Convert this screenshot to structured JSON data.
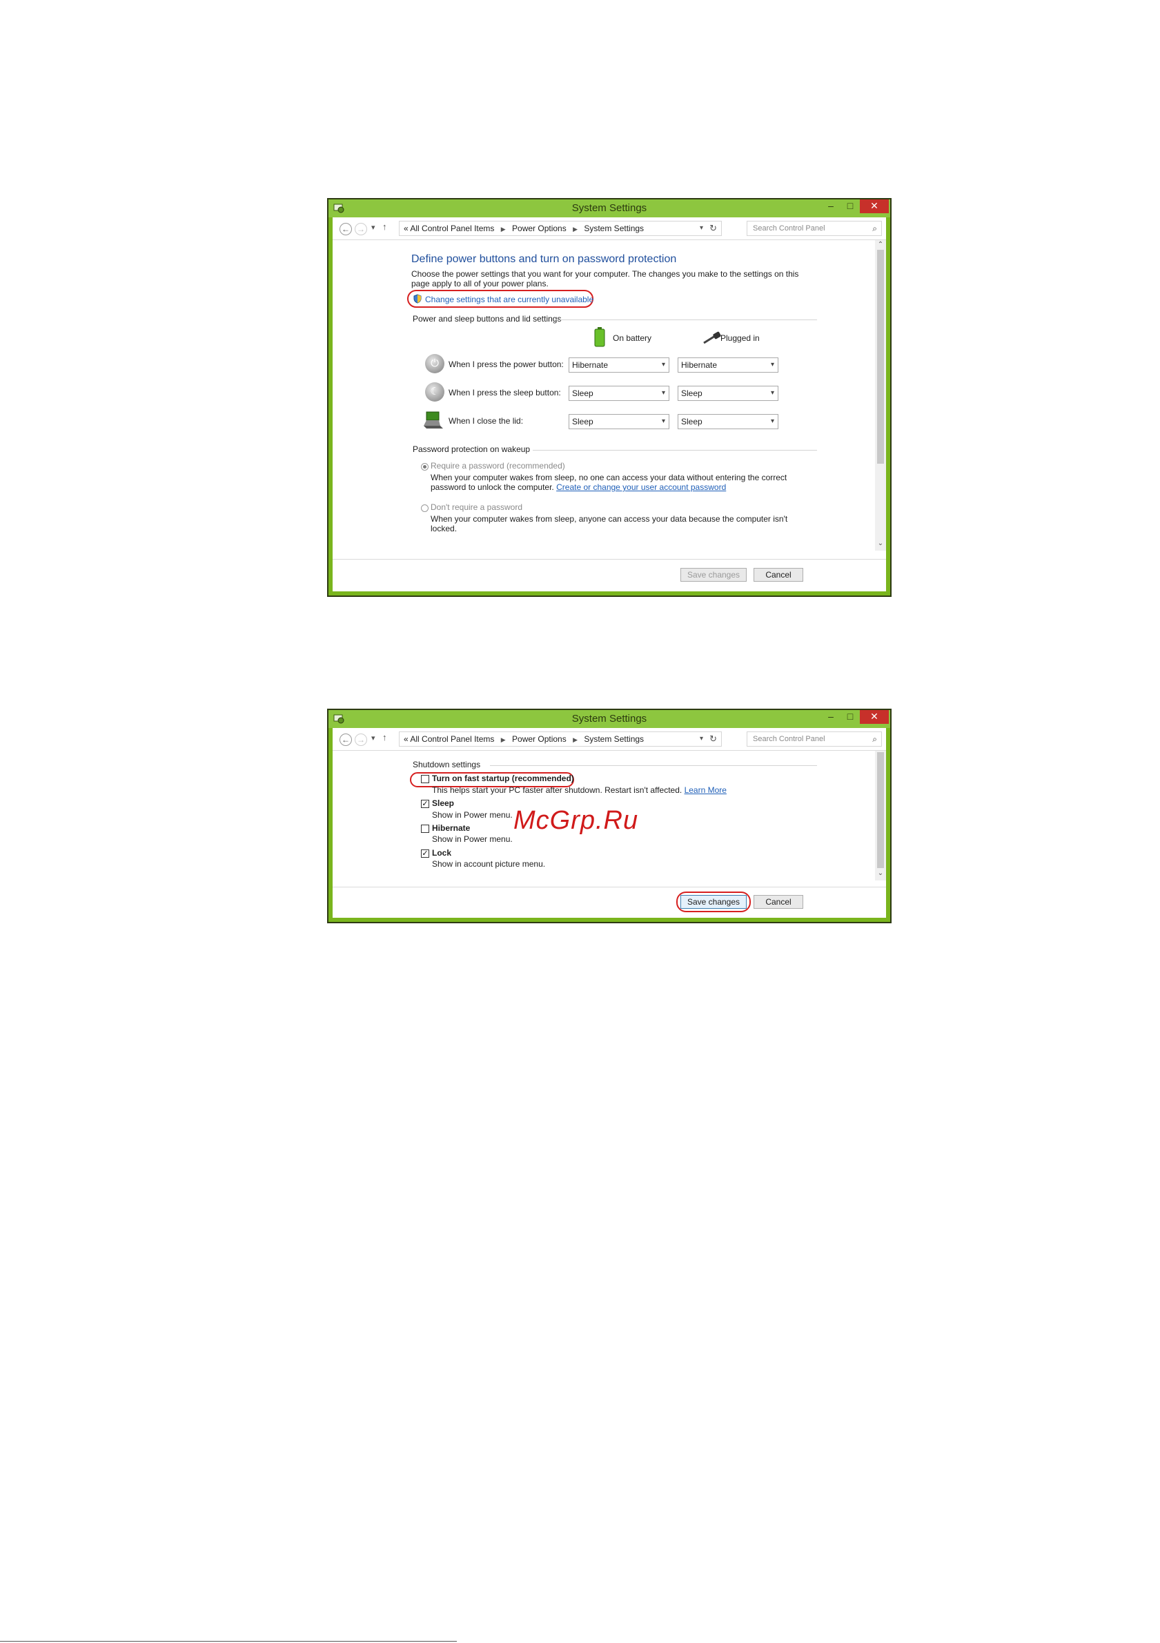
{
  "window1": {
    "title": "System Settings",
    "nav": {
      "back_icon": "back-arrow-icon",
      "forward_icon": "forward-arrow-icon",
      "breadcrumb_prefix": "«",
      "breadcrumb": [
        "All Control Panel Items",
        "Power Options",
        "System Settings"
      ],
      "search_placeholder": "Search Control Panel"
    },
    "heading": "Define power buttons and turn on password protection",
    "description_line1": "Choose the power settings that you want for your computer. The changes you make to the settings on this",
    "description_line2": "page apply to all of your power plans.",
    "change_link": "Change settings that are currently unavailable",
    "group_power": "Power and sleep buttons and lid settings",
    "col_battery": "On battery",
    "col_plugged": "Plugged in",
    "rows": [
      {
        "label": "When I press the power button:",
        "battery": "Hibernate",
        "plugged": "Hibernate"
      },
      {
        "label": "When I press the sleep button:",
        "battery": "Sleep",
        "plugged": "Sleep"
      },
      {
        "label": "When I close the lid:",
        "battery": "Sleep",
        "plugged": "Sleep"
      }
    ],
    "group_password": "Password protection on wakeup",
    "opt_require": "Require a password (recommended)",
    "opt_require_desc1": "When your computer wakes from sleep, no one can access your data without entering the correct",
    "opt_require_desc2": "password to unlock the computer.",
    "opt_require_link": "Create or change your user account password",
    "opt_norequire": "Don't require a password",
    "opt_norequire_desc1": "When your computer wakes from sleep, anyone can access your data because the computer isn't",
    "opt_norequire_desc2": "locked.",
    "save_label": "Save changes",
    "cancel_label": "Cancel"
  },
  "window2": {
    "title": "System Settings",
    "nav": {
      "breadcrumb_prefix": "«",
      "breadcrumb": [
        "All Control Panel Items",
        "Power Options",
        "System Settings"
      ],
      "search_placeholder": "Search Control Panel"
    },
    "group_shutdown": "Shutdown settings",
    "options": [
      {
        "label": "Turn on fast startup (recommended)",
        "desc": "This helps start your PC faster after shutdown. Restart isn't affected.",
        "checked": false
      },
      {
        "label": "Sleep",
        "desc": "Show in Power menu.",
        "checked": true
      },
      {
        "label": "Hibernate",
        "desc": "Show in Power menu.",
        "checked": false
      },
      {
        "label": "Lock",
        "desc": "Show in account picture menu.",
        "checked": true
      }
    ],
    "learn_more": "Learn More",
    "save_label": "Save changes",
    "cancel_label": "Cancel"
  },
  "watermark": "McGrp.Ru",
  "colors": {
    "titlebar": "#8dc63f",
    "frame": "#7ab51d",
    "highlight_ring": "#d62020",
    "link": "#1f5fb8"
  }
}
